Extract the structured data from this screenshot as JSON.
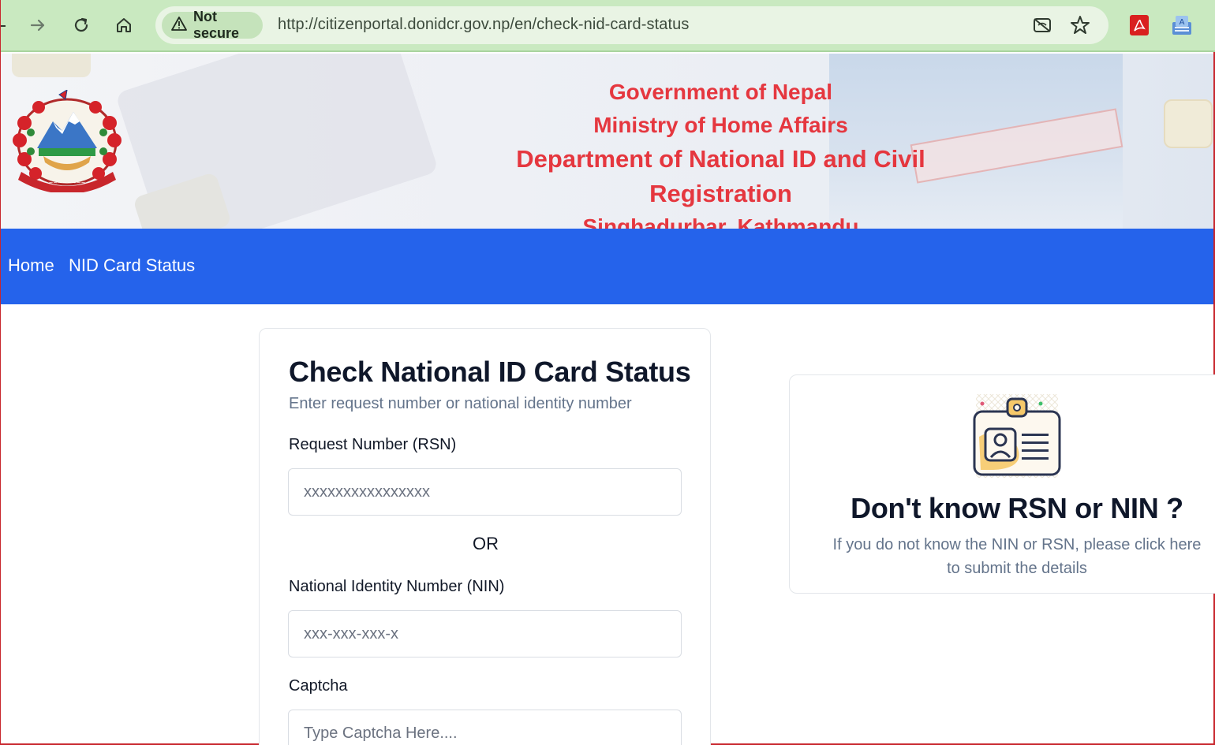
{
  "browser": {
    "security_label": "Not secure",
    "url": "http://citizenportal.donidcr.gov.np/en/check-nid-card-status",
    "icons": [
      "back-icon",
      "forward-icon",
      "reload-icon",
      "home-icon",
      "warning-icon",
      "eye-off-icon",
      "star-icon",
      "pdf-extension-icon",
      "translate-extension-icon"
    ]
  },
  "header": {
    "line1": "Government of Nepal",
    "line2": "Ministry of Home Affairs",
    "line3": "Department of National ID and Civil Registration",
    "line4": "Singhadurbar, Kathmandu",
    "accent_color": "#e5373f"
  },
  "nav": {
    "items": [
      {
        "label": "Home"
      },
      {
        "label": "NID Card Status"
      }
    ],
    "bg_color": "#2563eb"
  },
  "form": {
    "title": "Check National ID Card Status",
    "subtitle": "Enter request number or national identity number",
    "rsn_label": "Request Number (RSN)",
    "rsn_placeholder": "xxxxxxxxxxxxxxxx",
    "or_text": "OR",
    "nin_label": "National Identity Number (NIN)",
    "nin_placeholder": "xxx-xxx-xxx-x",
    "captcha_label": "Captcha",
    "captcha_placeholder": "Type Captcha Here...."
  },
  "help": {
    "title": "Don't know RSN or NIN ?",
    "description": "If you do not know the NIN or RSN, please click here to submit the details"
  }
}
